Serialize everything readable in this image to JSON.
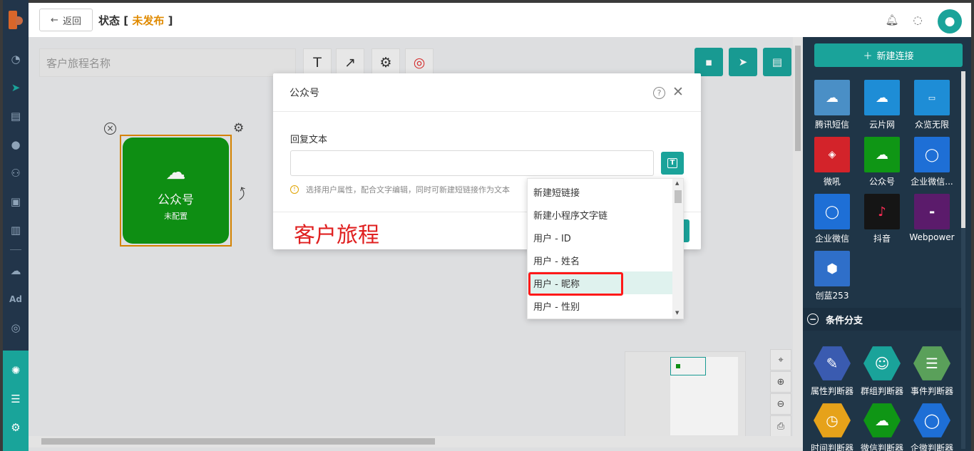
{
  "header": {
    "back_label": "返回",
    "status_label": "状态",
    "status_value": "未发布"
  },
  "toolbar": {
    "name_placeholder": "客户旅程名称",
    "text_tool": "T"
  },
  "node": {
    "title": "公众号",
    "subtitle": "未配置"
  },
  "modal": {
    "title": "公众号",
    "field_label": "回复文本",
    "t_button": "T",
    "hint": "选择用户属性，配合文字编辑，同时可新建短链接作为文本",
    "caption": "客户旅程"
  },
  "dropdown": {
    "items": [
      "新建短链接",
      "新建小程序文字链",
      "用户 - ID",
      "用户 - 姓名",
      "用户 - 昵称",
      "用户 - 性别"
    ],
    "highlighted_index": 4
  },
  "right_panel": {
    "new_connection": "新建连接",
    "channels": [
      {
        "label": "腾讯短信",
        "icon": "cloud-icon",
        "color": "#4a8fc6"
      },
      {
        "label": "云片网",
        "icon": "cloud-outline-icon",
        "color": "#1e8dd6"
      },
      {
        "label": "众览无限",
        "icon": "weiwei-icon",
        "color": "#1e8dd6"
      },
      {
        "label": "微吼",
        "icon": "weihou-icon",
        "color": "#d3232a"
      },
      {
        "label": "公众号",
        "icon": "wechat-icon",
        "color": "#0f9615"
      },
      {
        "label": "企业微信...",
        "icon": "wecom-icon",
        "color": "#1e6fd6"
      },
      {
        "label": "企业微信",
        "icon": "wecom-icon",
        "color": "#1e6fd6"
      },
      {
        "label": "抖音",
        "icon": "tiktok-icon",
        "color": "#151515"
      },
      {
        "label": "Webpower",
        "icon": "webpower-icon",
        "color": "#5b1b6b"
      },
      {
        "label": "创蓝253",
        "icon": "chuanglan-icon",
        "color": "#2f6fc9"
      }
    ],
    "section_title": "条件分支",
    "branches": [
      {
        "label": "属性判断器",
        "icon": "edit-icon",
        "color": "#3a5bb0"
      },
      {
        "label": "群组判断器",
        "icon": "group-icon",
        "color": "#1aa39a"
      },
      {
        "label": "事件判断器",
        "icon": "list-icon",
        "color": "#5aa05a"
      },
      {
        "label": "时间判断器",
        "icon": "clock-icon",
        "color": "#e6a21a"
      },
      {
        "label": "微信判断器",
        "icon": "wechat-icon",
        "color": "#0f9615"
      },
      {
        "label": "企微判断器",
        "icon": "wecom-icon",
        "color": "#1e6fd6"
      }
    ]
  },
  "colors": {
    "accent": "#1aa39a",
    "sidebar": "#22354a",
    "node_green": "#0f9615",
    "status_orange": "#e08a00",
    "annotation_red": "#ff1a1a"
  }
}
